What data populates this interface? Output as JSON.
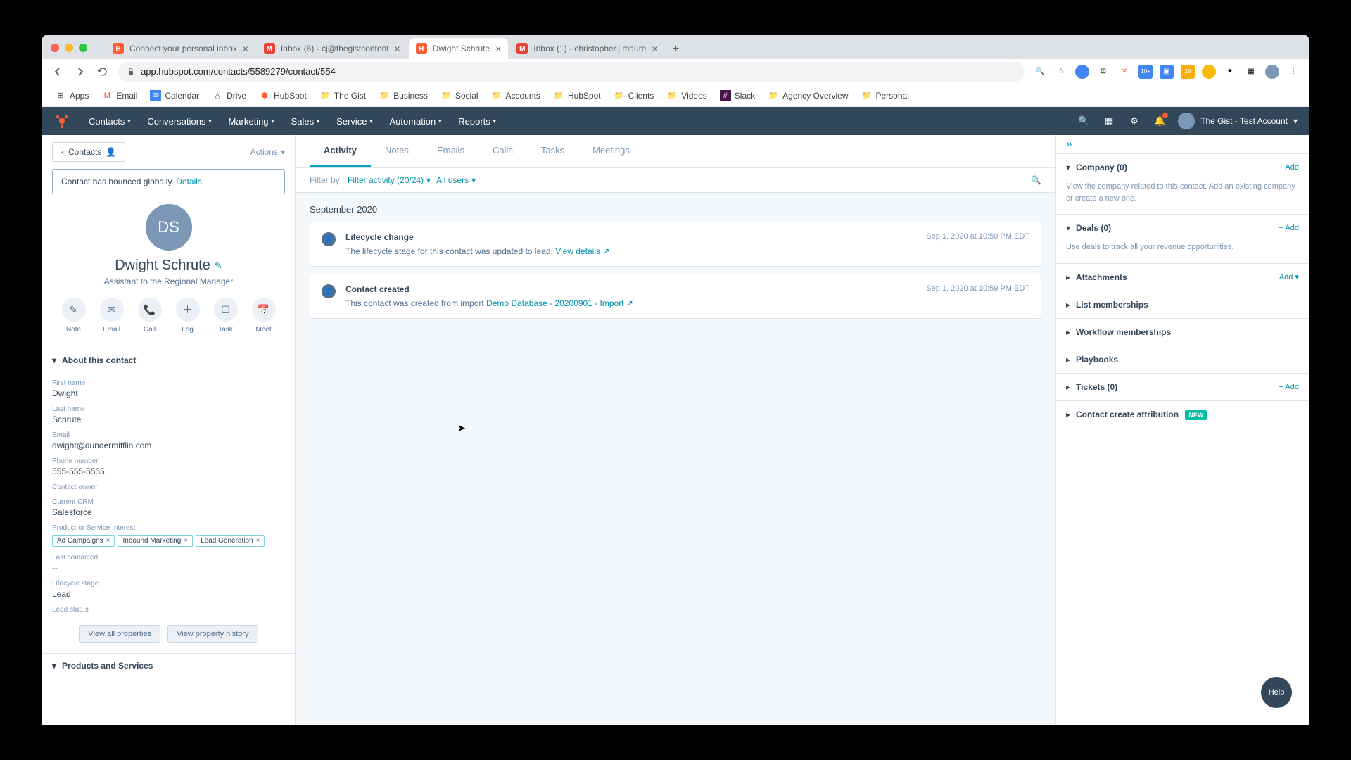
{
  "browser": {
    "tabs": [
      {
        "title": "Connect your personal inbox",
        "favicon_bg": "#ff5c35",
        "favicon_text": "H",
        "active": false
      },
      {
        "title": "Inbox (6) - cj@thegistcontent",
        "favicon_bg": "#ea4335",
        "favicon_text": "M",
        "active": false
      },
      {
        "title": "Dwight Schrute",
        "favicon_bg": "#ff5c35",
        "favicon_text": "H",
        "active": true
      },
      {
        "title": "Inbox (1) - christopher.j.maure",
        "favicon_bg": "#ea4335",
        "favicon_text": "M",
        "active": false
      }
    ],
    "url": "app.hubspot.com/contacts/5589279/contact/554"
  },
  "bookmarks": [
    {
      "label": "Apps",
      "icon": "⊞"
    },
    {
      "label": "Email",
      "icon": "M"
    },
    {
      "label": "Calendar",
      "icon": "📅"
    },
    {
      "label": "Drive",
      "icon": "△"
    },
    {
      "label": "HubSpot",
      "icon": "⬢"
    },
    {
      "label": "The Gist",
      "icon": "📁"
    },
    {
      "label": "Business",
      "icon": "📁"
    },
    {
      "label": "Social",
      "icon": "📁"
    },
    {
      "label": "Accounts",
      "icon": "📁"
    },
    {
      "label": "HubSpot",
      "icon": "📁"
    },
    {
      "label": "Clients",
      "icon": "📁"
    },
    {
      "label": "Videos",
      "icon": "📁"
    },
    {
      "label": "Slack",
      "icon": "#"
    },
    {
      "label": "Agency Overview",
      "icon": "📁"
    },
    {
      "label": "Personal",
      "icon": "📁"
    }
  ],
  "hs_nav": {
    "items": [
      "Contacts",
      "Conversations",
      "Marketing",
      "Sales",
      "Service",
      "Automation",
      "Reports"
    ],
    "account": "The Gist - Test Account"
  },
  "left": {
    "back": "Contacts",
    "actions": "Actions",
    "bounce_text": "Contact has bounced globally.",
    "bounce_link": "Details",
    "initials": "DS",
    "name": "Dwight Schrute",
    "title": "Assistant to the Regional Manager",
    "actions_row": [
      {
        "icon": "✎",
        "label": "Note"
      },
      {
        "icon": "✉",
        "label": "Email"
      },
      {
        "icon": "📞",
        "label": "Call"
      },
      {
        "icon": "＋",
        "label": "Log"
      },
      {
        "icon": "☐",
        "label": "Task"
      },
      {
        "icon": "📅",
        "label": "Meet"
      }
    ],
    "about_header": "About this contact",
    "props": {
      "first_name_label": "First name",
      "first_name": "Dwight",
      "last_name_label": "Last name",
      "last_name": "Schrute",
      "email_label": "Email",
      "email": "dwight@dundermifflin.com",
      "phone_label": "Phone number",
      "phone": "555-555-5555",
      "owner_label": "Contact owner",
      "owner": "",
      "crm_label": "Current CRM",
      "crm": "Salesforce",
      "interest_label": "Product or Service Interest",
      "tags": [
        "Ad Campaigns",
        "Inbound Marketing",
        "Lead Generation"
      ],
      "last_contacted_label": "Last contacted",
      "last_contacted": "--",
      "lifecycle_label": "Lifecycle stage",
      "lifecycle": "Lead",
      "lead_status_label": "Lead status",
      "lead_status": ""
    },
    "view_all": "View all properties",
    "view_history": "View property history",
    "products_header": "Products and Services"
  },
  "center": {
    "tabs": [
      "Activity",
      "Notes",
      "Emails",
      "Calls",
      "Tasks",
      "Meetings"
    ],
    "filter_label": "Filter by:",
    "filter_activity": "Filter activity (20/24)",
    "all_users": "All users",
    "month": "September 2020",
    "events": [
      {
        "title": "Lifecycle change",
        "desc": "The lifecycle stage for this contact was updated to lead.",
        "link": "View details",
        "date": "Sep 1, 2020 at 10:59 PM EDT"
      },
      {
        "title": "Contact created",
        "desc": "This contact was created from import",
        "link": "Demo Database - 20200901 - Import",
        "date": "Sep 1, 2020 at 10:59 PM EDT"
      }
    ]
  },
  "right": {
    "sections": [
      {
        "title": "Company (0)",
        "add": "+ Add",
        "body": "View the company related to this contact. Add an existing company or create a new one.",
        "chevron": "▾"
      },
      {
        "title": "Deals (0)",
        "add": "+ Add",
        "body": "Use deals to track all your revenue opportunities.",
        "chevron": "▾"
      },
      {
        "title": "Attachments",
        "add": "Add ▾",
        "body": "",
        "chevron": "▸"
      },
      {
        "title": "List memberships",
        "add": "",
        "body": "",
        "chevron": "▸"
      },
      {
        "title": "Workflow memberships",
        "add": "",
        "body": "",
        "chevron": "▸"
      },
      {
        "title": "Playbooks",
        "add": "",
        "body": "",
        "chevron": "▸"
      },
      {
        "title": "Tickets (0)",
        "add": "+ Add",
        "body": "",
        "chevron": "▸"
      },
      {
        "title": "Contact create attribution",
        "add": "",
        "body": "",
        "chevron": "▸",
        "badge": "NEW"
      }
    ]
  },
  "help": "Help"
}
